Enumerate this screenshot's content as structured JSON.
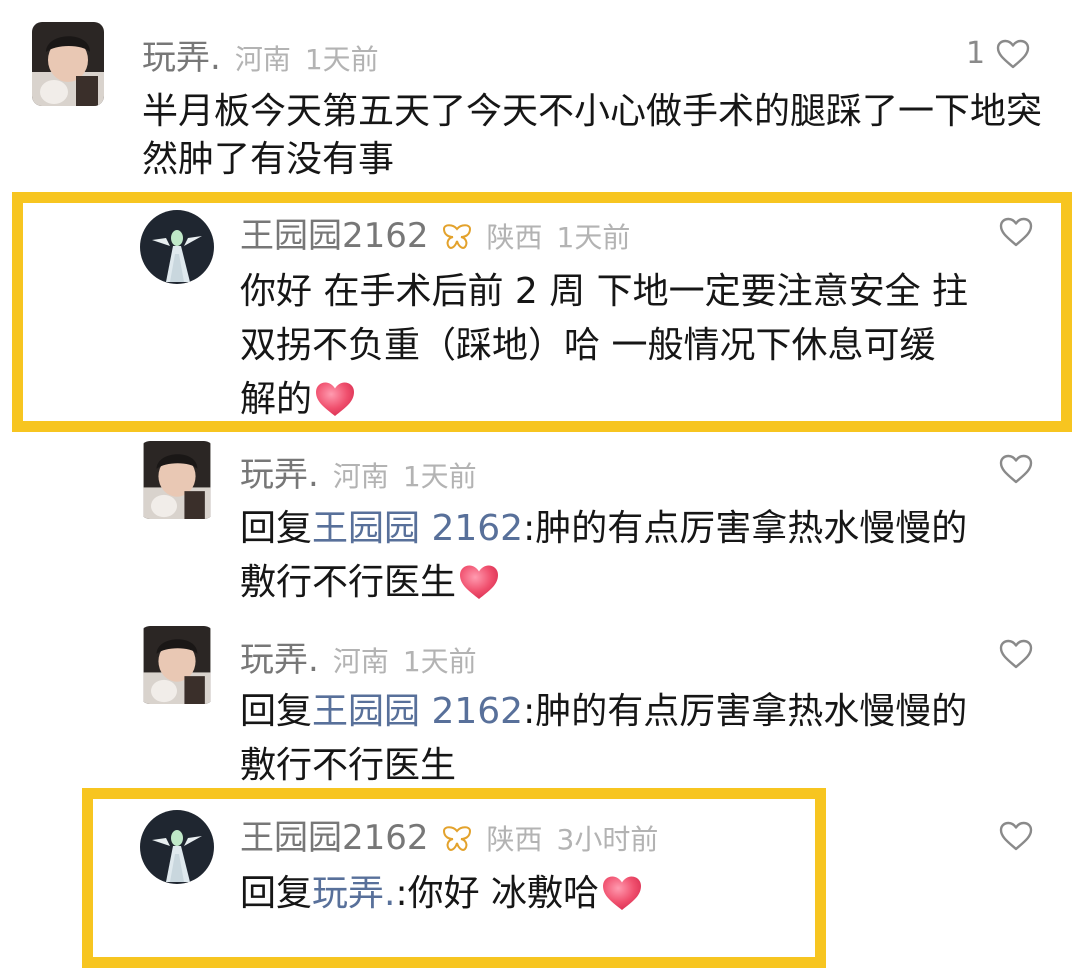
{
  "colors": {
    "highlight": "#f7c520",
    "mention": "#58709a",
    "meta": "#b3b3b3",
    "name": "#777777"
  },
  "comments": [
    {
      "user": "玩弄.",
      "location": "河南",
      "time": "1天前",
      "like_count": "1",
      "text": "半月板今天第五天了今天不小心做手术的腿踩了一下地突然肿了有没有事",
      "avatar": "photo-avatar"
    },
    {
      "user": "王园园2162",
      "badge": "butterfly-badge-icon",
      "location": "陕西",
      "time": "1天前",
      "text_line1": "你好 在手术后前 2 周 下地一定要注意安全 拄",
      "text_line2": "双拐不负重（踩地）哈 一般情况下休息可缓",
      "text_line3": "解的",
      "emoji": "heart-emoji-icon",
      "avatar": "figure-avatar"
    },
    {
      "user": "玩弄.",
      "location": "河南",
      "time": "1天前",
      "reply_prefix": "回复",
      "reply_to": "王园园 2162",
      "line1_rest": ":肿的有点厉害拿热水慢慢的",
      "line2": "敷行不行医生",
      "emoji": "heart-emoji-icon",
      "avatar": "photo-avatar"
    },
    {
      "user": "玩弄.",
      "location": "河南",
      "time": "1天前",
      "reply_prefix": "回复",
      "reply_to": "王园园 2162",
      "line1_rest": ":肿的有点厉害拿热水慢慢的",
      "line2": "敷行不行医生",
      "avatar": "photo-avatar"
    },
    {
      "user": "王园园2162",
      "badge": "butterfly-badge-icon",
      "location": "陕西",
      "time": "3小时前",
      "reply_prefix": "回复",
      "reply_to": "玩弄.",
      "rest": ":你好 冰敷哈",
      "emoji": "heart-emoji-icon",
      "avatar": "figure-avatar"
    }
  ]
}
